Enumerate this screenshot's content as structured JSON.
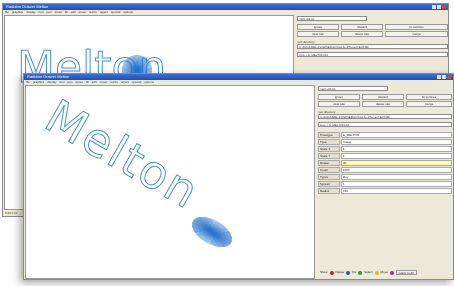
{
  "windows": {
    "back": {
      "title": "Radiator Drawer Melton",
      "menu": [
        "file",
        "graphics",
        "display",
        "font",
        "pen",
        "tones",
        "fill",
        "edit",
        "move",
        "resize",
        "layers",
        "special",
        "options",
        "window",
        "help"
      ],
      "logo_text": "Melton",
      "status": "0.00  0.00"
    },
    "front": {
      "title": "Radiator Drawer Melton",
      "menu": [
        "file",
        "graphics",
        "display",
        "font",
        "pen",
        "tones",
        "fill",
        "edit",
        "move",
        "resize",
        "layers",
        "special",
        "options",
        "window",
        "help"
      ],
      "logo_text": "Melton"
    }
  },
  "panel": {
    "top_field": "melt.v01.txt",
    "buttons_row1": [
      "ignore",
      "discard",
      "fix vertices"
    ],
    "buttons_row2": [
      "view rule",
      "delete rule",
      "merge"
    ],
    "dir_label": "root directory",
    "dir_field": "C:\\DOCUME~1\\OWNER\\LOCALS~1\\Temp\\TEXTMF",
    "path_field": "Line = 0_MELTON.fld",
    "props": [
      {
        "label": "Prototype",
        "value": "E_MELTON"
      },
      {
        "label": "Type",
        "value": "Image"
      },
      {
        "label": "Scale X",
        "value": "1"
      },
      {
        "label": "Scale Y",
        "value": "1"
      },
      {
        "label": "Rotate",
        "value": "30"
      },
      {
        "label": "Count",
        "value": "1000"
      },
      {
        "label": "Types",
        "value": "Ray"
      },
      {
        "label": "Spread",
        "value": "1"
      },
      {
        "label": "Radius",
        "value": "150"
      }
    ],
    "legend": {
      "items": [
        "Show",
        "Delete",
        "Fix",
        "Select",
        "Move"
      ],
      "colors": [
        "#d42020",
        "#2b54c8",
        "#30a030",
        "#d8c020",
        "#a030c0"
      ],
      "apply": "Apply to All"
    }
  },
  "colors": {
    "logo_stroke": "#4a90d9",
    "burst": "#2a77cc"
  }
}
